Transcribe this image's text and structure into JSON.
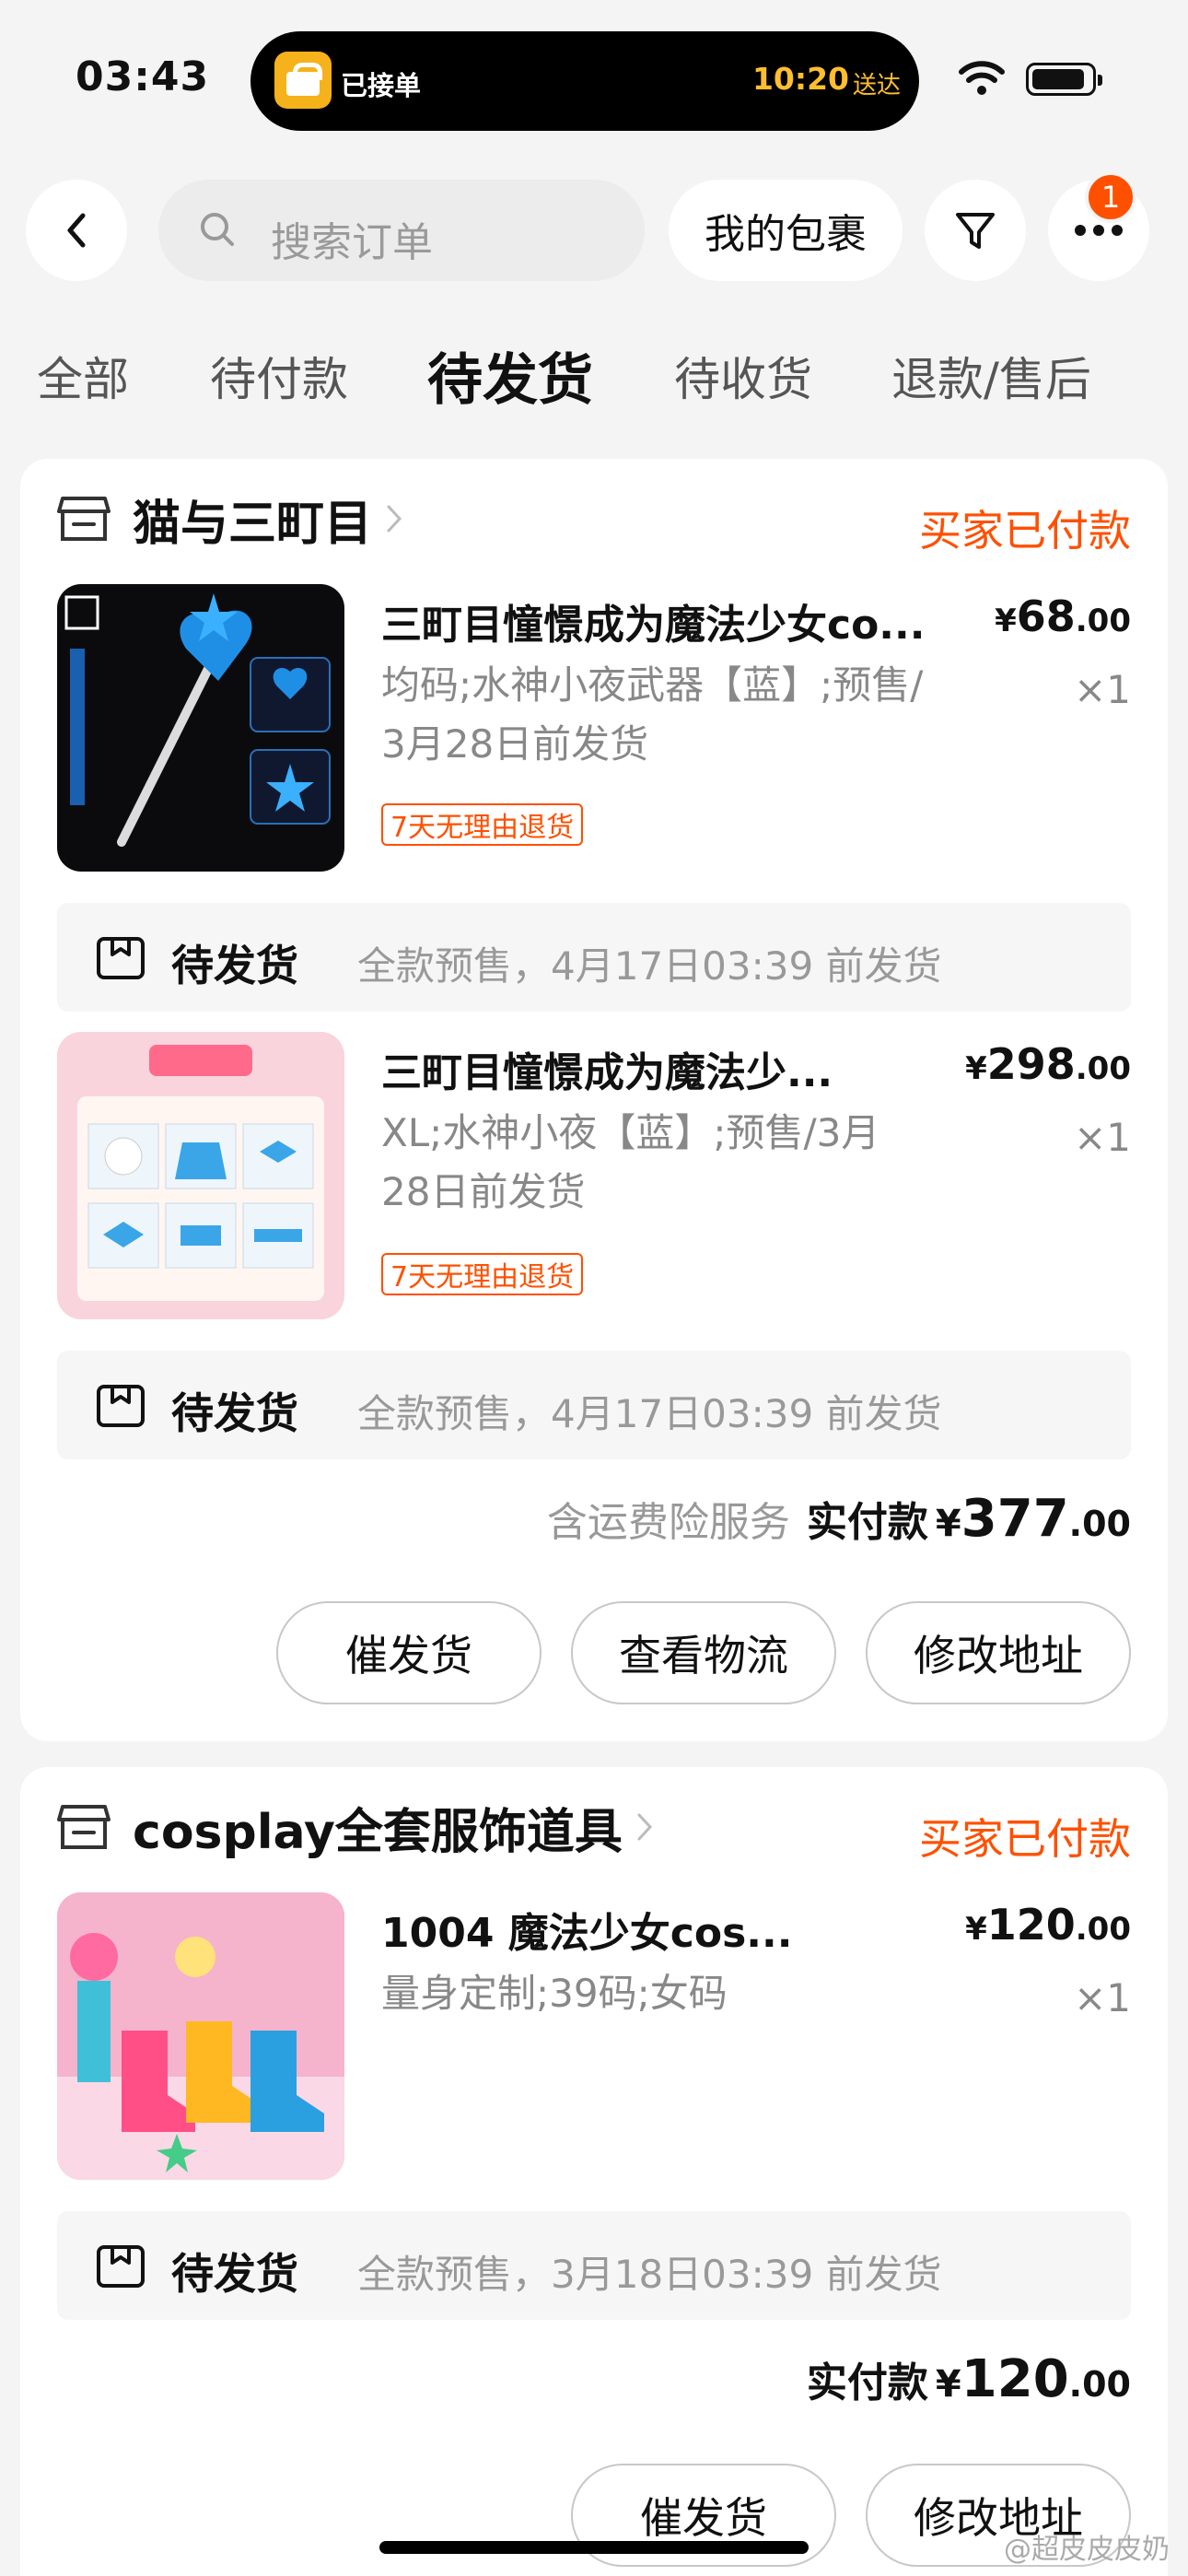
{
  "status_bar": {
    "time": "03:43",
    "island_label": "已接单",
    "island_time": "10:20",
    "island_time_suffix": "送达"
  },
  "nav": {
    "search_placeholder": "搜索订单",
    "packages_label": "我的包裹",
    "more_badge": "1"
  },
  "tabs": [
    {
      "label": "全部",
      "active": false
    },
    {
      "label": "待付款",
      "active": false
    },
    {
      "label": "待发货",
      "active": true
    },
    {
      "label": "待收货",
      "active": false
    },
    {
      "label": "退款/售后",
      "active": false
    }
  ],
  "orders": [
    {
      "shop_name": "猫与三町目",
      "status": "买家已付款",
      "items": [
        {
          "title": "三町目憧憬成为魔法少女co...",
          "spec_line1": "均码;水神小夜武器【蓝】;预售/",
          "spec_line2": "3月28日前发货",
          "price_currency": "¥",
          "price_int": "68",
          "price_dec": ".00",
          "qty": "×1",
          "tag": "7天无理由退货",
          "ship_label": "待发货",
          "ship_detail": "全款预售，4月17日03:39 前发货"
        },
        {
          "title": "三町目憧憬成为魔法少...",
          "spec_line1": "XL;水神小夜【蓝】;预售/3月",
          "spec_line2": "28日前发货",
          "price_currency": "¥",
          "price_int": "298",
          "price_dec": ".00",
          "qty": "×1",
          "tag": "7天无理由退货",
          "ship_label": "待发货",
          "ship_detail": "全款预售，4月17日03:39 前发货"
        }
      ],
      "total_note": "含运费险服务",
      "total_label": "实付款",
      "total_currency": "¥",
      "total_int": "377",
      "total_dec": ".00",
      "actions": [
        "催发货",
        "查看物流",
        "修改地址"
      ]
    },
    {
      "shop_name": "cosplay全套服饰道具",
      "status": "买家已付款",
      "items": [
        {
          "title": "1004 魔法少女cos...",
          "spec_line1": "量身定制;39码;女码",
          "price_currency": "¥",
          "price_int": "120",
          "price_dec": ".00",
          "qty": "×1",
          "ship_label": "待发货",
          "ship_detail": "全款预售，3月18日03:39 前发货"
        }
      ],
      "total_label": "实付款",
      "total_currency": "¥",
      "total_int": "120",
      "total_dec": ".00",
      "actions": [
        "催发货",
        "修改地址"
      ]
    }
  ],
  "watermark": "@超皮皮皮奶",
  "colors": {
    "accent": "#ff5000",
    "island_text": "#ffbe2e",
    "background": "#f4f4f4"
  }
}
